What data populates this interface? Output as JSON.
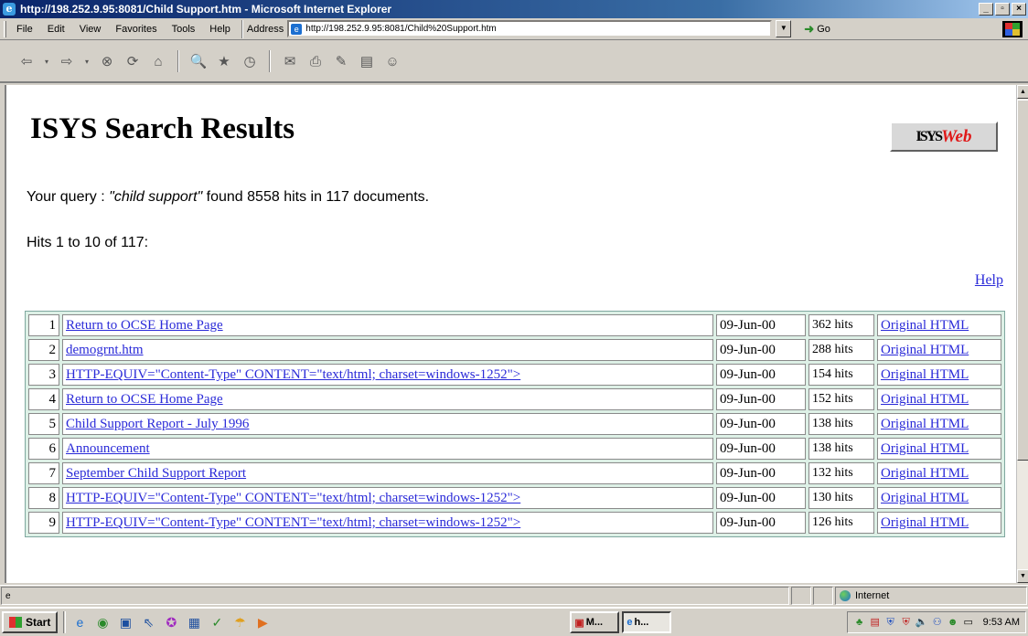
{
  "window": {
    "title": "http://198.252.9.95:8081/Child Support.htm - Microsoft Internet Explorer"
  },
  "menu": [
    "File",
    "Edit",
    "View",
    "Favorites",
    "Tools",
    "Help"
  ],
  "address": {
    "label": "Address",
    "url": "http://198.252.9.95:8081/Child%20Support.htm",
    "go": "Go"
  },
  "page": {
    "title": "ISYS Search Results",
    "logo": {
      "part1": "ISYS",
      "part2": "Web"
    },
    "query_prefix": "Your query : ",
    "query_term": "\"child support\"",
    "query_suffix": " found 8558 hits in 117 documents.",
    "hits_range": "Hits 1 to 10 of 117:",
    "help": "Help"
  },
  "results": [
    {
      "num": "1",
      "title": "Return to OCSE Home Page",
      "date": "09-Jun-00",
      "hits": "362 hits",
      "link": "Original HTML"
    },
    {
      "num": "2",
      "title": "demogrnt.htm",
      "date": "09-Jun-00",
      "hits": "288 hits",
      "link": "Original HTML"
    },
    {
      "num": "3",
      "title": "HTTP-EQUIV=\"Content-Type\" CONTENT=\"text/html; charset=windows-1252\">",
      "date": "09-Jun-00",
      "hits": "154 hits",
      "link": "Original HTML"
    },
    {
      "num": "4",
      "title": "Return to OCSE Home Page",
      "date": "09-Jun-00",
      "hits": "152 hits",
      "link": "Original HTML"
    },
    {
      "num": "5",
      "title": "Child Support Report - July 1996",
      "date": "09-Jun-00",
      "hits": "138 hits",
      "link": "Original HTML"
    },
    {
      "num": "6",
      "title": "Announcement",
      "date": "09-Jun-00",
      "hits": "138 hits",
      "link": "Original HTML"
    },
    {
      "num": "7",
      "title": "September Child Support Report",
      "date": "09-Jun-00",
      "hits": "132 hits",
      "link": "Original HTML"
    },
    {
      "num": "8",
      "title": "HTTP-EQUIV=\"Content-Type\" CONTENT=\"text/html; charset=windows-1252\">",
      "date": "09-Jun-00",
      "hits": "130 hits",
      "link": "Original HTML"
    },
    {
      "num": "9",
      "title": "HTTP-EQUIV=\"Content-Type\" CONTENT=\"text/html; charset=windows-1252\">",
      "date": "09-Jun-00",
      "hits": "126 hits",
      "link": "Original HTML"
    }
  ],
  "status": {
    "zone": "Internet"
  },
  "taskbar": {
    "start": "Start",
    "tasks": [
      "M...",
      "h..."
    ],
    "time": "9:53 AM"
  }
}
